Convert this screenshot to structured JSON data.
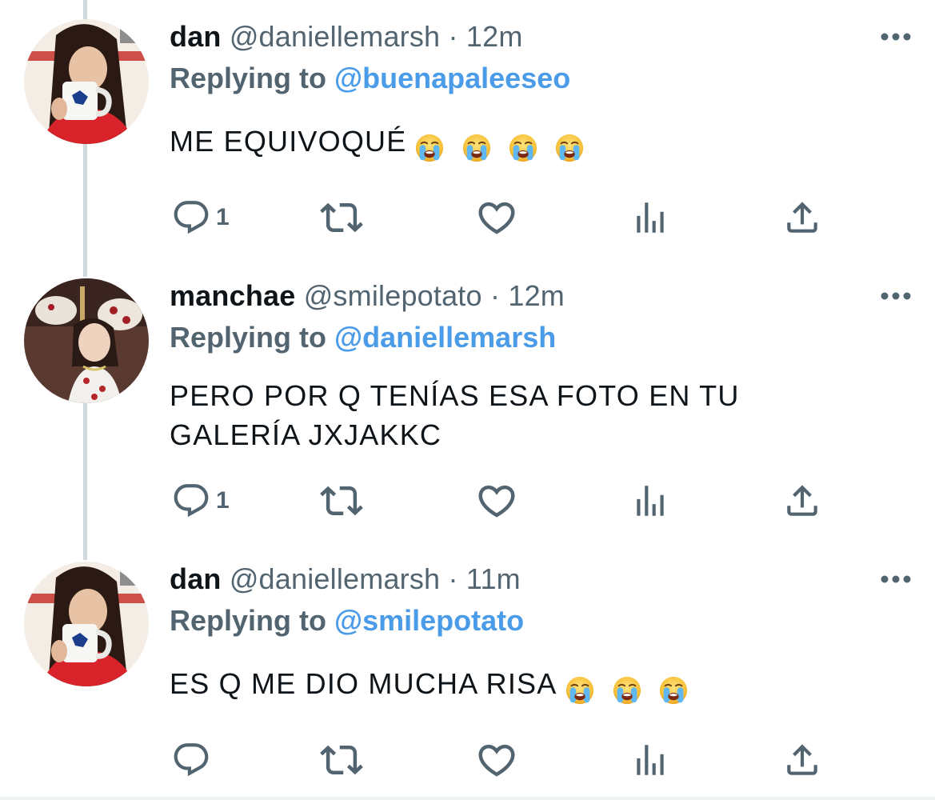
{
  "tweets": [
    {
      "name": "dan",
      "handle": "@daniellemarsh",
      "separator": "·",
      "time": "12m",
      "replying_label": "Replying to",
      "replying_to": "@buenapaleeseo",
      "text": "ME EQUIVOQUÉ",
      "emoji": [
        "loudly-crying-face",
        "loudly-crying-face",
        "loudly-crying-face",
        "loudly-crying-face"
      ],
      "reply_count": "1",
      "avatar": "avatar-girl-mug"
    },
    {
      "name": "manchae",
      "handle": "@smilepotato",
      "separator": "·",
      "time": "12m",
      "replying_label": "Replying to",
      "replying_to": "@daniellemarsh",
      "text_line1": "PERO POR Q TENÍAS ESA FOTO EN TU",
      "text_line2": "GALERÍA JXJAKKC",
      "reply_count": "1",
      "avatar": "avatar-carousel"
    },
    {
      "name": "dan",
      "handle": "@daniellemarsh",
      "separator": "·",
      "time": "11m",
      "replying_label": "Replying to",
      "replying_to": "@smilepotato",
      "text": "ES Q ME DIO MUCHA RISA",
      "emoji": [
        "loudly-crying-face",
        "loudly-crying-face",
        "loudly-crying-face"
      ],
      "reply_count": "",
      "avatar": "avatar-girl-mug"
    }
  ],
  "colors": {
    "name": "#0f1419",
    "secondary": "#536471",
    "link": "#4a9be8",
    "thread_line": "#cfd9de",
    "icon": "#536471"
  },
  "action_icons": [
    "reply-icon",
    "retweet-icon",
    "like-icon",
    "views-icon",
    "share-icon"
  ]
}
